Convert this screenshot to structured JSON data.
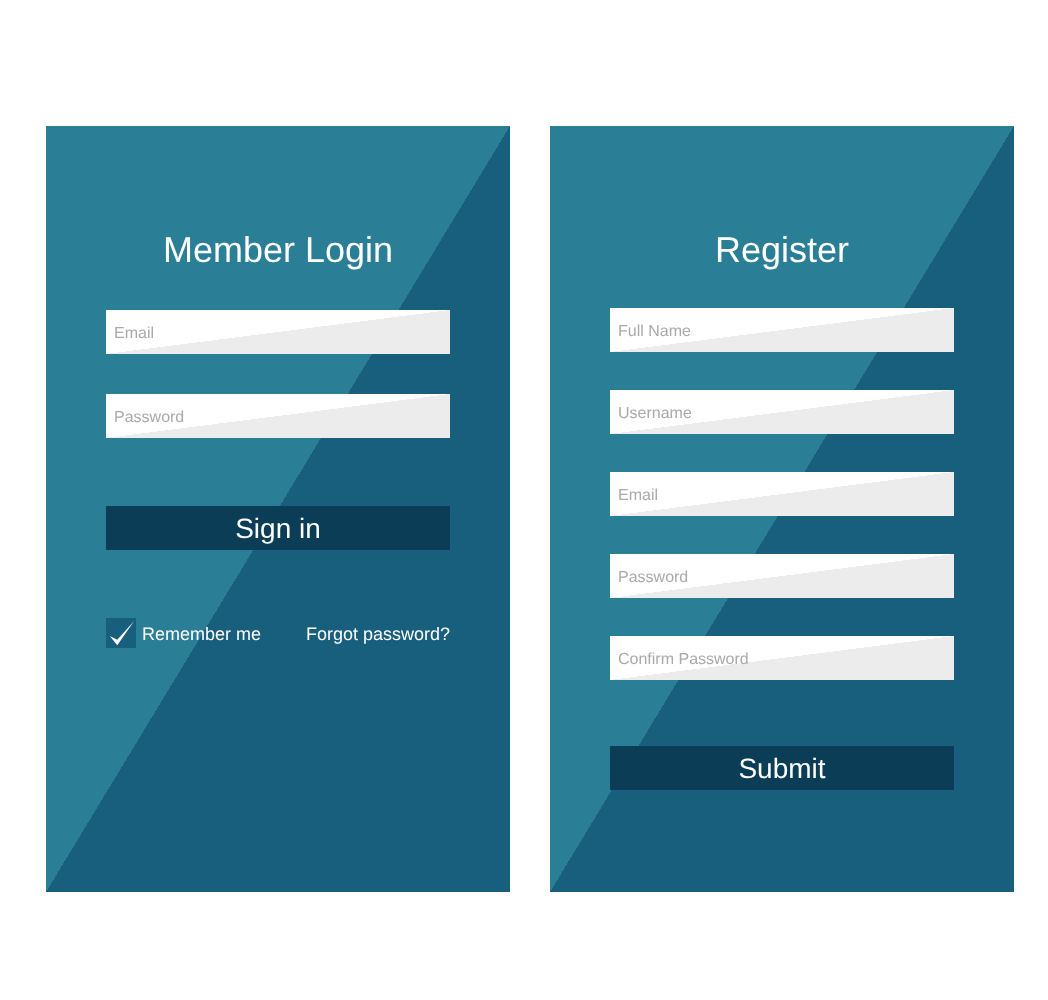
{
  "login": {
    "title": "Member Login",
    "fields": [
      {
        "placeholder": "Email"
      },
      {
        "placeholder": "Password"
      }
    ],
    "button": "Sign in",
    "remember": {
      "label": "Remember me",
      "checked": true
    },
    "forgot_link": "Forgot password?"
  },
  "register": {
    "title": "Register",
    "fields": [
      {
        "placeholder": "Full Name"
      },
      {
        "placeholder": "Username"
      },
      {
        "placeholder": "Email"
      },
      {
        "placeholder": "Password"
      },
      {
        "placeholder": "Confirm Password"
      }
    ],
    "button": "Submit"
  }
}
